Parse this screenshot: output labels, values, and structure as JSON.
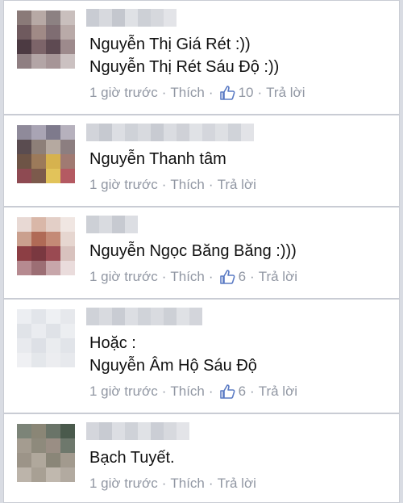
{
  "comments": [
    {
      "lines": [
        "Nguyễn Thị Giá Rét :))",
        "Nguyễn Thị Rét Sáu Độ :))"
      ],
      "time": "1 giờ trước",
      "like_label": "Thích",
      "likes": "10",
      "reply_label": "Trả lời"
    },
    {
      "lines": [
        "Nguyễn Thanh tâm"
      ],
      "time": "1 giờ trước",
      "like_label": "Thích",
      "likes": null,
      "reply_label": "Trả lời"
    },
    {
      "lines": [
        "Nguyễn Ngọc Băng Băng :)))"
      ],
      "time": "1 giờ trước",
      "like_label": "Thích",
      "likes": "6",
      "reply_label": "Trả lời"
    },
    {
      "lines": [
        "Hoặc :",
        "Nguyễn Âm Hộ Sáu Độ"
      ],
      "time": "1 giờ trước",
      "like_label": "Thích",
      "likes": "6",
      "reply_label": "Trả lời"
    },
    {
      "lines": [
        "Bạch Tuyết."
      ],
      "time": "1 giờ trước",
      "like_label": "Thích",
      "likes": null,
      "reply_label": "Trả lời"
    }
  ],
  "colors": {
    "meta_text": "#9197a3",
    "like_icon": "#5b7bc4",
    "comment_text": "#111111"
  },
  "icons": {
    "like": "thumbs-up-icon"
  }
}
